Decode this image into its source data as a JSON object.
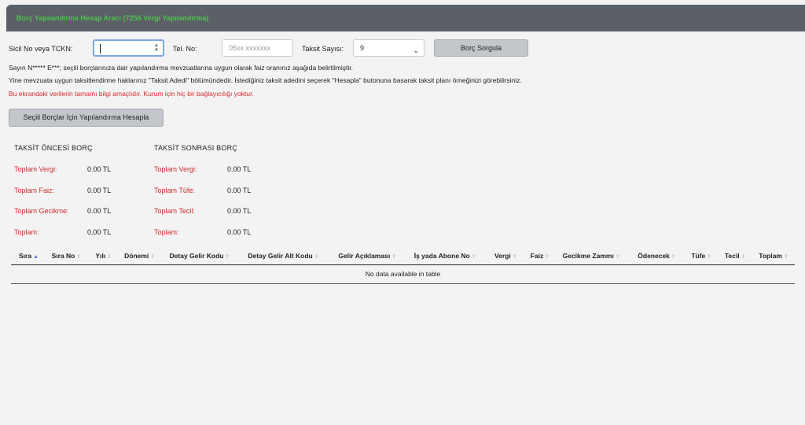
{
  "header": {
    "title": "Borç Yapılandırma Hesap Aracı (7256 Vergi Yapılandırma)"
  },
  "form": {
    "sicil_label": "Sicil No veya TCKN:",
    "sicil_value": "",
    "tel_label": "Tel. No:",
    "tel_placeholder": "05xx xxxxxxx",
    "taksit_label": "Taksit Sayısı:",
    "taksit_value": "9",
    "query_button": "Borç Sorgula"
  },
  "info": {
    "line1": "Sayın N***** E***; seçili borçlarınıza dair yapılandırma mevzuatlarına uygun olarak faiz oranınız aşağıda belirtilmiştir.",
    "line2": "Yine mevzuata uygun taksitlendirme haklarınız \"Taksit Adedi\" bölümündedir. İstediğiniz taksit adedini seçerek \"Hesapla\" butonuna basarak taksit planı örneğinizi görebilirsiniz.",
    "warning": "Bu ekrandaki verilerin tamamı bilgi amaçlıdır. Kurum için hiç bir bağlayıcılığı yoktur."
  },
  "calc_button": "Seçili Borçlar İçin Yapılandırma Hesapla",
  "summary": {
    "before": {
      "heading": "TAKSİT ÖNCESİ BORÇ",
      "rows": [
        {
          "label": "Toplam Vergi:",
          "value": "0.00 TL"
        },
        {
          "label": "Toplam Faiz:",
          "value": "0.00 TL"
        },
        {
          "label": "Toplam Gecikme:",
          "value": "0.00 TL"
        },
        {
          "label": "Toplam:",
          "value": "0.00 TL"
        }
      ]
    },
    "after": {
      "heading": "TAKSİT SONRASI BORÇ",
      "rows": [
        {
          "label": "Toplam Vergi:",
          "value": "0.00 TL"
        },
        {
          "label": "Toplam Tüfe:",
          "value": "0.00 TL"
        },
        {
          "label": "Toplam Tecil:",
          "value": "0.00 TL"
        },
        {
          "label": "Toplam:",
          "value": "0.00 TL"
        }
      ]
    }
  },
  "table": {
    "columns": [
      "Sıra",
      "Sıra No",
      "Yılı",
      "Dönemi",
      "Detay Gelir Kodu",
      "Detay Gelir Alt Kodu",
      "Gelir Açıklaması",
      "İş yada Abone No",
      "Vergi",
      "Faiz",
      "Gecikme Zammı",
      "Ödenecek",
      "Tüfe",
      "Tecil",
      "Toplam"
    ],
    "empty_message": "No data available in table"
  }
}
